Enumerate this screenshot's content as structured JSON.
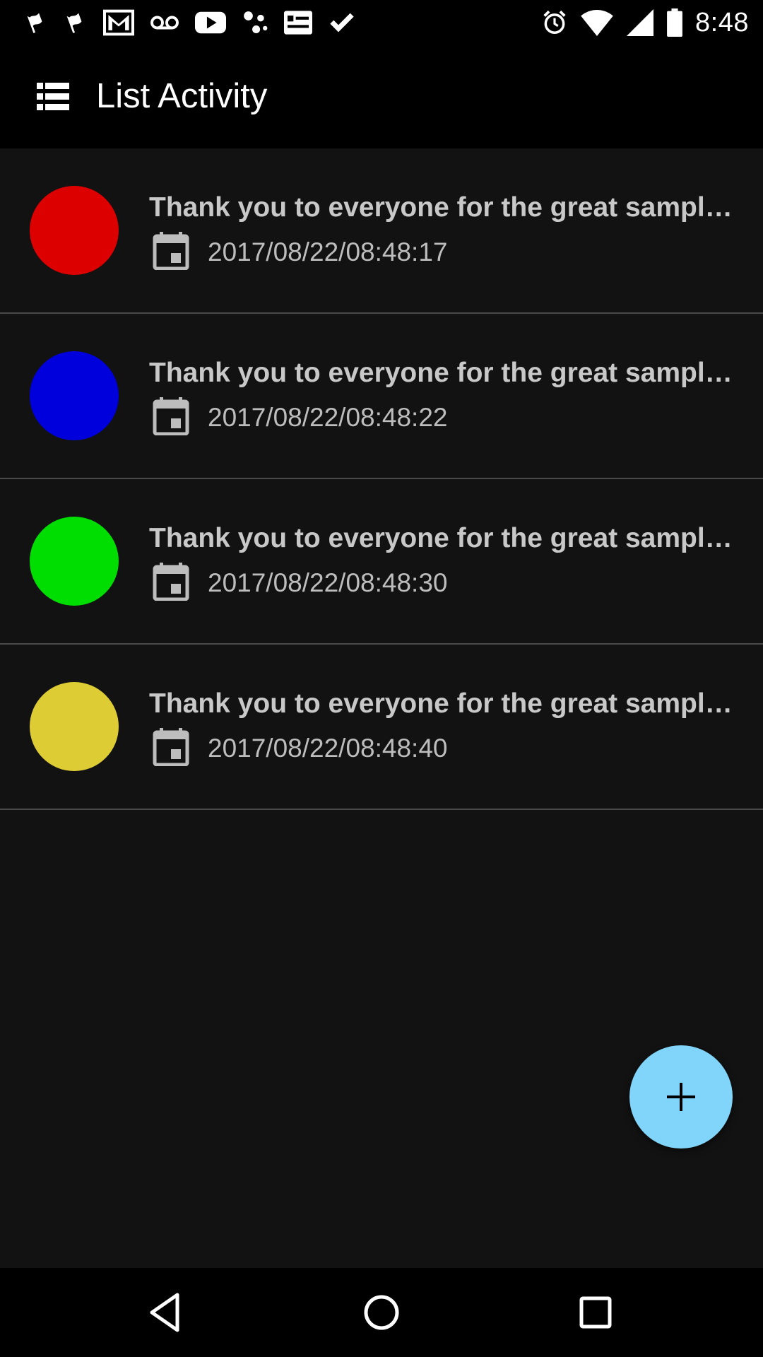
{
  "status_bar": {
    "time": "8:48",
    "left_icons": [
      "flag-icon",
      "flag-icon",
      "gmail-icon",
      "voicemail-icon",
      "youtube-icon",
      "dots-icon",
      "news-icon",
      "check-icon"
    ],
    "right_icons": [
      "alarm-icon",
      "wifi-icon",
      "signal-icon",
      "battery-icon"
    ]
  },
  "toolbar": {
    "icon": "list-icon",
    "title": "List Activity"
  },
  "list": {
    "items": [
      {
        "title": "Thank you to everyone for the great sample projects",
        "date": "2017/08/22/08:48:17",
        "color": "#dd0000"
      },
      {
        "title": "Thank you to everyone for the great sample projects",
        "date": "2017/08/22/08:48:22",
        "color": "#0000dd"
      },
      {
        "title": "Thank you to everyone for the great sample projects",
        "date": "2017/08/22/08:48:30",
        "color": "#00dd00"
      },
      {
        "title": "Thank you to everyone for the great sample projects",
        "date": "2017/08/22/08:48:40",
        "color": "#ddcc33"
      }
    ]
  },
  "fab": {
    "icon": "plus-icon",
    "color": "#81d4fa"
  },
  "nav_bar": {
    "icons": [
      "back-icon",
      "home-icon",
      "recents-icon"
    ]
  },
  "colors": {
    "background": "#121212",
    "bars": "#000000",
    "divider": "#4a4a4a",
    "text": "#c8c8c8"
  }
}
